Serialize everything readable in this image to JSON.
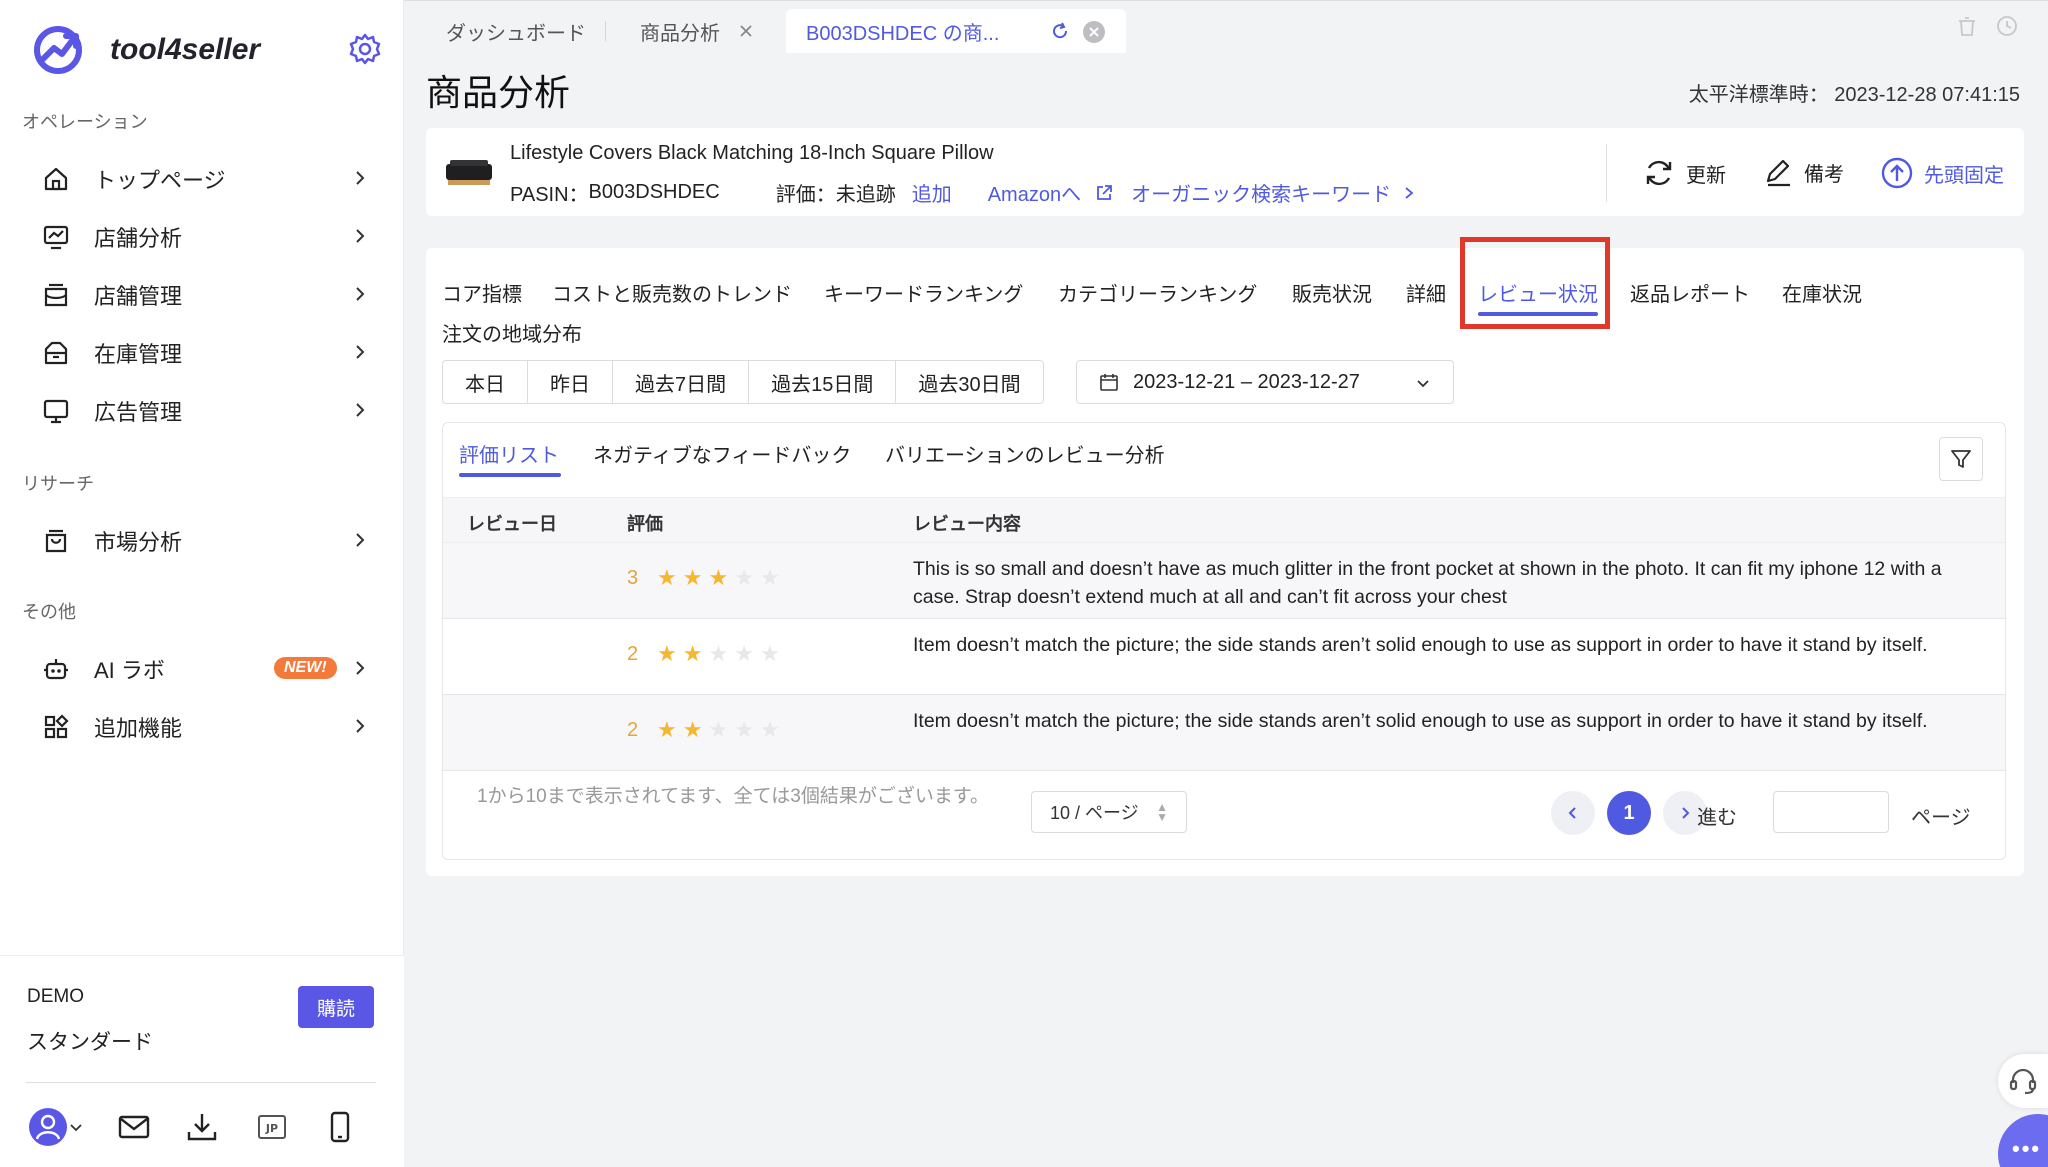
{
  "app": {
    "name": "tool4seller"
  },
  "sidebar": {
    "sections": [
      {
        "label": "オペレーション"
      },
      {
        "label": "リサーチ"
      },
      {
        "label": "その他"
      }
    ],
    "items": [
      {
        "label": "トップページ",
        "icon": "home-icon"
      },
      {
        "label": "店舗分析",
        "icon": "chart-monitor-icon"
      },
      {
        "label": "店舗管理",
        "icon": "store-icon"
      },
      {
        "label": "在庫管理",
        "icon": "inventory-icon"
      },
      {
        "label": "広告管理",
        "icon": "monitor-icon"
      },
      {
        "label": "市場分析",
        "icon": "bag-icon"
      },
      {
        "label": "AI ラボ",
        "icon": "robot-icon",
        "badge": "NEW!"
      },
      {
        "label": "追加機能",
        "icon": "apps-icon"
      }
    ],
    "account": {
      "name": "DEMO",
      "plan": "スタンダード",
      "subscribe_label": "購読"
    }
  },
  "tabs": [
    {
      "label": "ダッシュボード"
    },
    {
      "label": "商品分析"
    },
    {
      "label": "B003DSHDEC の商..."
    }
  ],
  "page": {
    "title": "商品分析",
    "timezone_label": "太平洋標準時：",
    "timestamp": "2023-12-28 07:41:15"
  },
  "product": {
    "name": "Lifestyle Covers Black Matching 18-Inch Square Pillow",
    "asin_label": "PASIN：",
    "asin": "B003DSHDEC",
    "rating_label": "評価：",
    "rating_value": "未追跡",
    "add_label": "追加",
    "amazon_label": "Amazonへ",
    "organic_label": "オーガニック検索キーワード",
    "actions": {
      "refresh": "更新",
      "note": "備考",
      "pin": "先頭固定"
    }
  },
  "analysis_tabs": [
    {
      "label": "コア指標"
    },
    {
      "label": "コストと販売数のトレンド"
    },
    {
      "label": "キーワードランキング"
    },
    {
      "label": "カテゴリーランキング"
    },
    {
      "label": "販売状況"
    },
    {
      "label": "詳細"
    },
    {
      "label": "レビュー状況",
      "active": true
    },
    {
      "label": "返品レポート"
    },
    {
      "label": "在庫状況"
    },
    {
      "label": "注文の地域分布"
    }
  ],
  "ranges": [
    {
      "label": "本日"
    },
    {
      "label": "昨日"
    },
    {
      "label": "過去7日間"
    },
    {
      "label": "過去15日間"
    },
    {
      "label": "過去30日間"
    }
  ],
  "date_range": "2023-12-21  –  2023-12-27",
  "review_tabs": [
    {
      "label": "評価リスト",
      "active": true
    },
    {
      "label": "ネガティブなフィードバック"
    },
    {
      "label": "バリエーションのレビュー分析"
    }
  ],
  "table": {
    "headers": [
      "レビュー日",
      "評価",
      "レビュー内容"
    ],
    "rows": [
      {
        "date": "",
        "rating": 3,
        "content": "This is so small and doesn’t have as much glitter in the front pocket at shown in the photo. It can fit my iphone 12 with a case. Strap doesn’t extend much at all and can’t fit across your chest"
      },
      {
        "date": "",
        "rating": 2,
        "content": "Item doesn’t match the picture; the side stands aren’t solid enough to use as support in order to have it stand by itself."
      },
      {
        "date": "",
        "rating": 2,
        "content": "Item doesn’t match the picture; the side stands aren’t solid enough to use as support in order to have it stand by itself."
      }
    ]
  },
  "pagination": {
    "info": "1から10まで表示されてます、全ては3個結果がございます。",
    "page_size": "10 / ページ",
    "current_page": "1",
    "goto_label": "進む",
    "page_label": "ページ"
  },
  "colors": {
    "accent": "#4f5ae0",
    "star": "#f5b731",
    "highlight": "#e0392b"
  }
}
